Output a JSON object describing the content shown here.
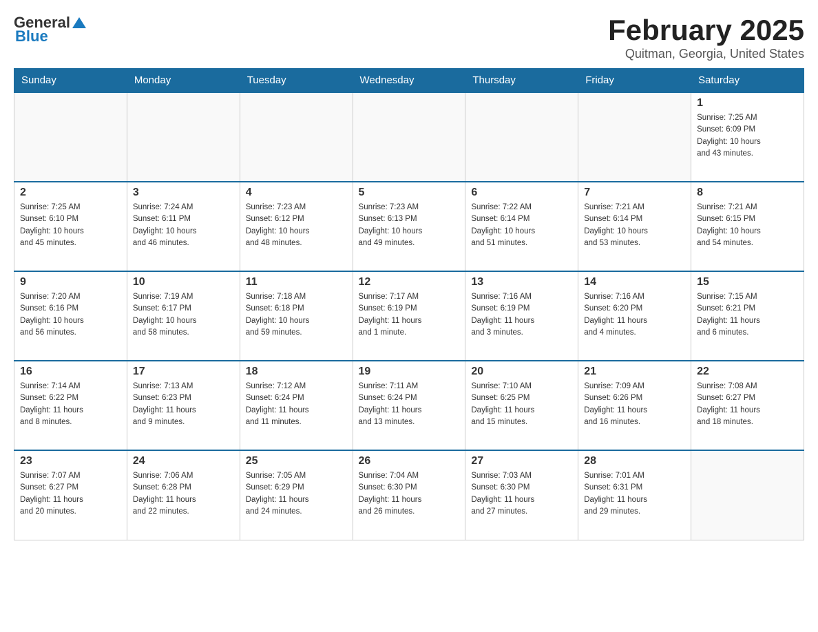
{
  "logo": {
    "general": "General",
    "blue": "Blue"
  },
  "title": "February 2025",
  "subtitle": "Quitman, Georgia, United States",
  "days_of_week": [
    "Sunday",
    "Monday",
    "Tuesday",
    "Wednesday",
    "Thursday",
    "Friday",
    "Saturday"
  ],
  "weeks": [
    [
      {
        "day": "",
        "info": ""
      },
      {
        "day": "",
        "info": ""
      },
      {
        "day": "",
        "info": ""
      },
      {
        "day": "",
        "info": ""
      },
      {
        "day": "",
        "info": ""
      },
      {
        "day": "",
        "info": ""
      },
      {
        "day": "1",
        "info": "Sunrise: 7:25 AM\nSunset: 6:09 PM\nDaylight: 10 hours\nand 43 minutes."
      }
    ],
    [
      {
        "day": "2",
        "info": "Sunrise: 7:25 AM\nSunset: 6:10 PM\nDaylight: 10 hours\nand 45 minutes."
      },
      {
        "day": "3",
        "info": "Sunrise: 7:24 AM\nSunset: 6:11 PM\nDaylight: 10 hours\nand 46 minutes."
      },
      {
        "day": "4",
        "info": "Sunrise: 7:23 AM\nSunset: 6:12 PM\nDaylight: 10 hours\nand 48 minutes."
      },
      {
        "day": "5",
        "info": "Sunrise: 7:23 AM\nSunset: 6:13 PM\nDaylight: 10 hours\nand 49 minutes."
      },
      {
        "day": "6",
        "info": "Sunrise: 7:22 AM\nSunset: 6:14 PM\nDaylight: 10 hours\nand 51 minutes."
      },
      {
        "day": "7",
        "info": "Sunrise: 7:21 AM\nSunset: 6:14 PM\nDaylight: 10 hours\nand 53 minutes."
      },
      {
        "day": "8",
        "info": "Sunrise: 7:21 AM\nSunset: 6:15 PM\nDaylight: 10 hours\nand 54 minutes."
      }
    ],
    [
      {
        "day": "9",
        "info": "Sunrise: 7:20 AM\nSunset: 6:16 PM\nDaylight: 10 hours\nand 56 minutes."
      },
      {
        "day": "10",
        "info": "Sunrise: 7:19 AM\nSunset: 6:17 PM\nDaylight: 10 hours\nand 58 minutes."
      },
      {
        "day": "11",
        "info": "Sunrise: 7:18 AM\nSunset: 6:18 PM\nDaylight: 10 hours\nand 59 minutes."
      },
      {
        "day": "12",
        "info": "Sunrise: 7:17 AM\nSunset: 6:19 PM\nDaylight: 11 hours\nand 1 minute."
      },
      {
        "day": "13",
        "info": "Sunrise: 7:16 AM\nSunset: 6:19 PM\nDaylight: 11 hours\nand 3 minutes."
      },
      {
        "day": "14",
        "info": "Sunrise: 7:16 AM\nSunset: 6:20 PM\nDaylight: 11 hours\nand 4 minutes."
      },
      {
        "day": "15",
        "info": "Sunrise: 7:15 AM\nSunset: 6:21 PM\nDaylight: 11 hours\nand 6 minutes."
      }
    ],
    [
      {
        "day": "16",
        "info": "Sunrise: 7:14 AM\nSunset: 6:22 PM\nDaylight: 11 hours\nand 8 minutes."
      },
      {
        "day": "17",
        "info": "Sunrise: 7:13 AM\nSunset: 6:23 PM\nDaylight: 11 hours\nand 9 minutes."
      },
      {
        "day": "18",
        "info": "Sunrise: 7:12 AM\nSunset: 6:24 PM\nDaylight: 11 hours\nand 11 minutes."
      },
      {
        "day": "19",
        "info": "Sunrise: 7:11 AM\nSunset: 6:24 PM\nDaylight: 11 hours\nand 13 minutes."
      },
      {
        "day": "20",
        "info": "Sunrise: 7:10 AM\nSunset: 6:25 PM\nDaylight: 11 hours\nand 15 minutes."
      },
      {
        "day": "21",
        "info": "Sunrise: 7:09 AM\nSunset: 6:26 PM\nDaylight: 11 hours\nand 16 minutes."
      },
      {
        "day": "22",
        "info": "Sunrise: 7:08 AM\nSunset: 6:27 PM\nDaylight: 11 hours\nand 18 minutes."
      }
    ],
    [
      {
        "day": "23",
        "info": "Sunrise: 7:07 AM\nSunset: 6:27 PM\nDaylight: 11 hours\nand 20 minutes."
      },
      {
        "day": "24",
        "info": "Sunrise: 7:06 AM\nSunset: 6:28 PM\nDaylight: 11 hours\nand 22 minutes."
      },
      {
        "day": "25",
        "info": "Sunrise: 7:05 AM\nSunset: 6:29 PM\nDaylight: 11 hours\nand 24 minutes."
      },
      {
        "day": "26",
        "info": "Sunrise: 7:04 AM\nSunset: 6:30 PM\nDaylight: 11 hours\nand 26 minutes."
      },
      {
        "day": "27",
        "info": "Sunrise: 7:03 AM\nSunset: 6:30 PM\nDaylight: 11 hours\nand 27 minutes."
      },
      {
        "day": "28",
        "info": "Sunrise: 7:01 AM\nSunset: 6:31 PM\nDaylight: 11 hours\nand 29 minutes."
      },
      {
        "day": "",
        "info": ""
      }
    ]
  ]
}
